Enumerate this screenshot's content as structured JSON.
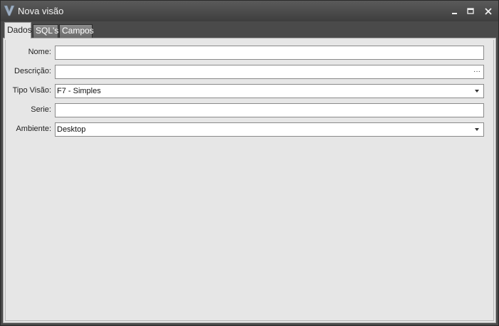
{
  "window": {
    "title": "Nova visão",
    "minimize": "🗕",
    "maximize": "🗖",
    "close": "✕"
  },
  "tabs": [
    {
      "label": "Dados",
      "active": true
    },
    {
      "label": "SQL's",
      "active": false
    },
    {
      "label": "Campos",
      "active": false
    }
  ],
  "form": {
    "nome": {
      "label": "Nome:",
      "value": ""
    },
    "descricao": {
      "label": "Descrição:",
      "value": "",
      "button": "···"
    },
    "tipo_visao": {
      "label": "Tipo Visão:",
      "value": "F7 - Simples"
    },
    "serie": {
      "label": "Serie:",
      "value": ""
    },
    "ambiente": {
      "label": "Ambiente:",
      "value": "Desktop"
    }
  },
  "colors": {
    "titlebar": "#4a4a4a",
    "panel": "#e6e6e6"
  },
  "icons": {
    "app": "app-logo-icon",
    "minimize": "minimize-icon",
    "maximize": "maximize-icon",
    "close": "close-icon",
    "dropdown": "chevron-down-icon",
    "ellipsis": "ellipsis-icon"
  }
}
